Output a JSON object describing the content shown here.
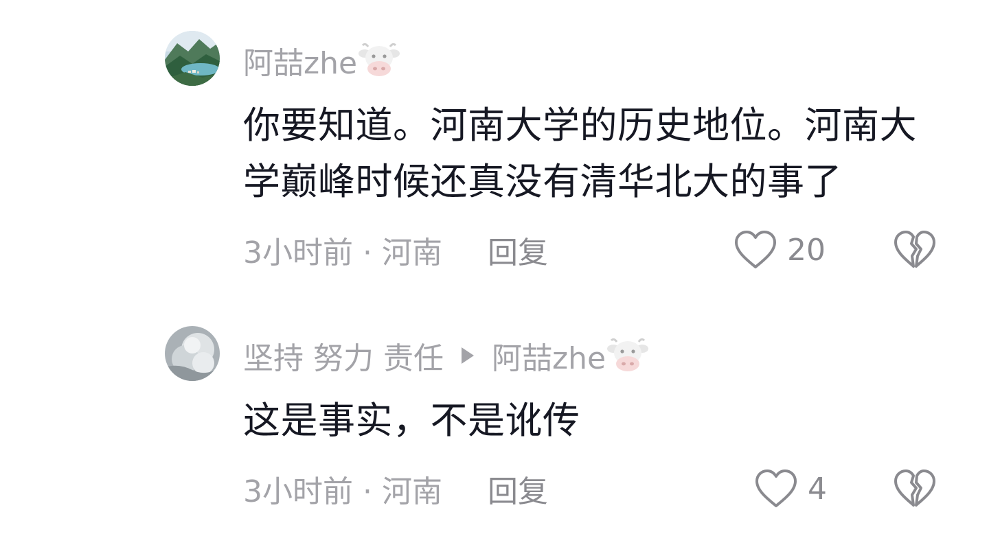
{
  "comments": [
    {
      "username": "阿喆zhe",
      "username_suffix_icon": "cow-face-icon",
      "text": "你要知道。河南大学的历史地位。河南大学巅峰时候还真没有清华北大的事了",
      "time_location": "3小时前 · 河南",
      "reply_label": "回复",
      "like_count": "20"
    },
    {
      "username": "坚持 努力 责任",
      "reply_to": "阿喆zhe",
      "username_suffix_icon": "cow-face-icon",
      "text": "这是事实，不是讹传",
      "time_location": "3小时前 · 河南",
      "reply_label": "回复",
      "like_count": "4"
    }
  ],
  "colors": {
    "meta_gray": "#a3a3a8",
    "text": "#161823",
    "icon_gray": "#8a8a8f"
  }
}
